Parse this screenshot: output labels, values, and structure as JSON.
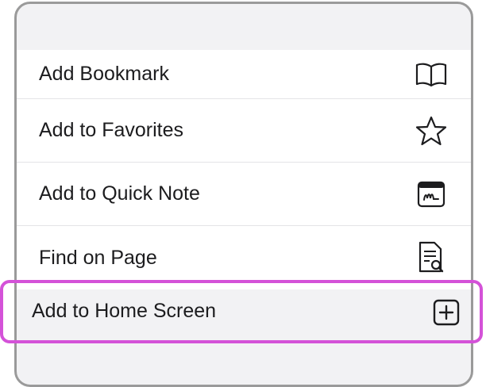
{
  "menu": {
    "items": [
      {
        "label": "Add Bookmark",
        "icon": "book-icon"
      },
      {
        "label": "Add to Favorites",
        "icon": "star-icon"
      },
      {
        "label": "Add to Quick Note",
        "icon": "quick-note-icon"
      },
      {
        "label": "Find on Page",
        "icon": "find-on-page-icon"
      }
    ],
    "highlighted_item": {
      "label": "Add to Home Screen",
      "icon": "plus-square-icon"
    }
  },
  "colors": {
    "highlight": "#d452d8",
    "frame_border": "#9a9a9a",
    "background": "#f2f2f4"
  }
}
